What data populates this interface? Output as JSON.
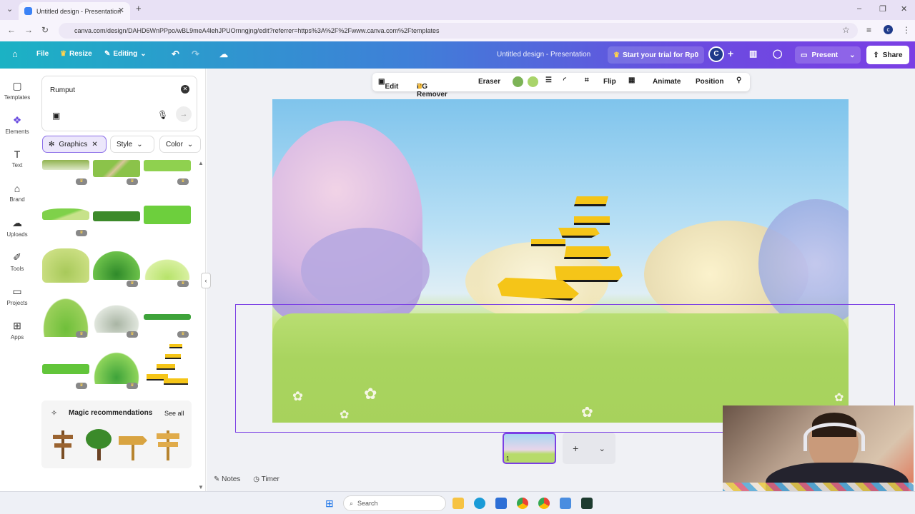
{
  "browser": {
    "tab_title": "Untitled design - Presentation",
    "url": "canva.com/design/DAHD6WnPPpo/wBL9meA4lehJPUOrnngjng/edit?referrer=https%3A%2F%2Fwww.canva.com%2Ftemplates"
  },
  "topbar": {
    "file": "File",
    "resize": "Resize",
    "editing": "Editing",
    "doc_title": "Untitled design - Presentation",
    "trial": "Start your trial for Rp0",
    "avatar": "C",
    "present": "Present",
    "share": "Share"
  },
  "rail": {
    "items": [
      {
        "label": "Templates",
        "icon": "templates-icon"
      },
      {
        "label": "Elements",
        "icon": "elements-icon"
      },
      {
        "label": "Text",
        "icon": "text-icon"
      },
      {
        "label": "Brand",
        "icon": "brand-icon"
      },
      {
        "label": "Uploads",
        "icon": "uploads-icon"
      },
      {
        "label": "Tools",
        "icon": "tools-icon"
      },
      {
        "label": "Projects",
        "icon": "projects-icon"
      },
      {
        "label": "Apps",
        "icon": "apps-icon"
      }
    ]
  },
  "panel": {
    "search_value": "Rumput",
    "chips": {
      "graphics": "Graphics",
      "style": "Style",
      "color": "Color"
    },
    "magic_title": "Magic recommendations",
    "see_all": "See all"
  },
  "context_toolbar": {
    "edit": "Edit",
    "bg_remover": "BG Remover",
    "eraser": "Eraser",
    "flip": "Flip",
    "animate": "Animate",
    "position": "Position",
    "colors": [
      "#7cb356",
      "#a9d46a"
    ]
  },
  "footer": {
    "page_number": "1",
    "notes": "Notes",
    "timer": "Timer"
  },
  "taskbar": {
    "search_placeholder": "Search"
  }
}
